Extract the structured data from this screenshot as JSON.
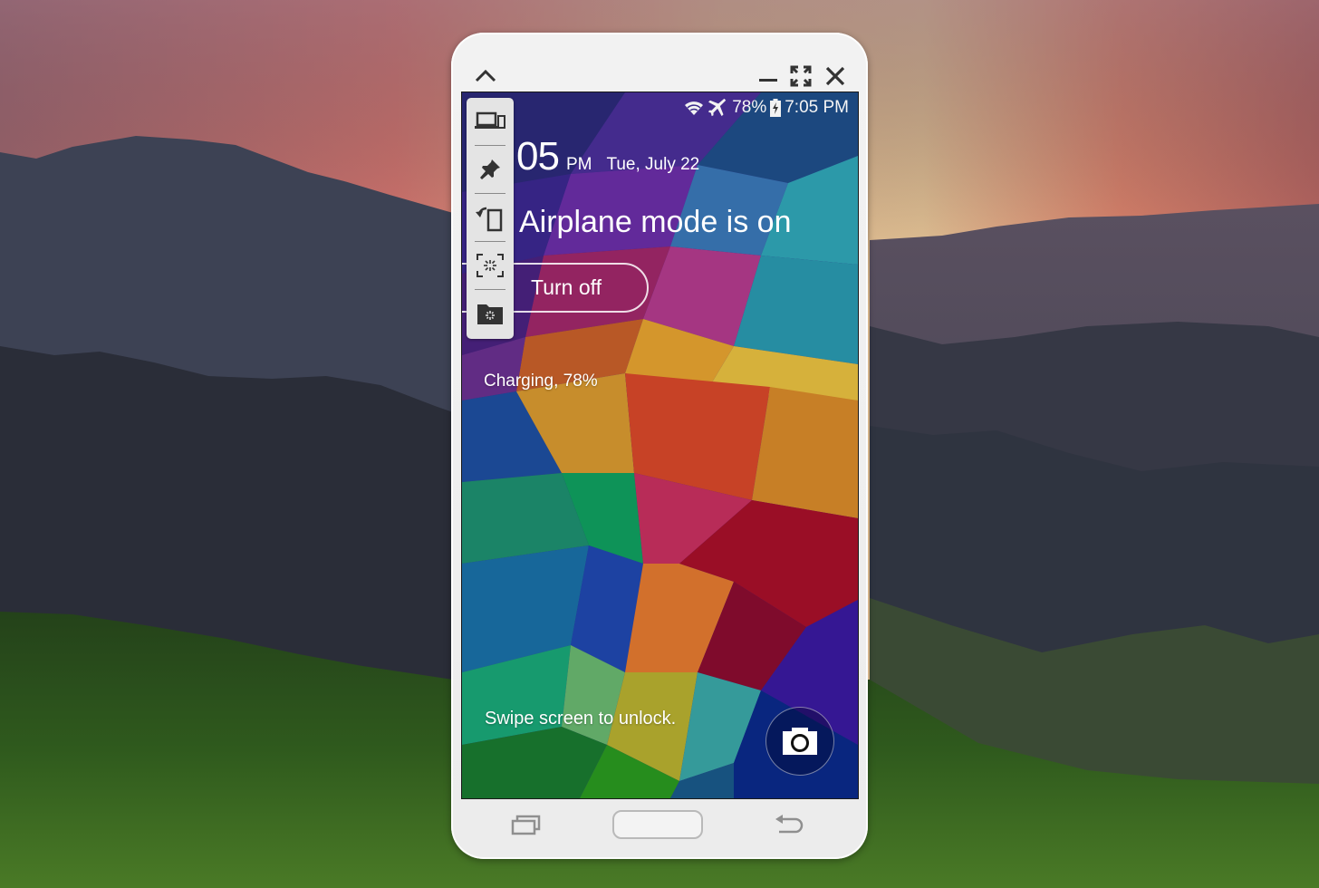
{
  "window": {
    "controls": {
      "collapse": "chevron-up",
      "minimize": "minimize",
      "maximize": "fullscreen",
      "close": "close"
    }
  },
  "status_bar": {
    "icons": [
      "wifi",
      "airplane-mode",
      "battery-charging"
    ],
    "battery_percent": "78%",
    "time": "7:05 PM"
  },
  "lockscreen": {
    "clock_minutes": "05",
    "clock_ampm": "PM",
    "date": "Tue, July 22",
    "notification_title": "Airplane mode is on",
    "turn_off_label": "Turn off",
    "charging_text": "Charging, 78%",
    "swipe_text": "Swipe screen to unlock.",
    "camera_shortcut": "camera"
  },
  "toolbar": {
    "items": [
      {
        "name": "device-screen",
        "icon": "laptop-phone"
      },
      {
        "name": "pin-window",
        "icon": "pin"
      },
      {
        "name": "rotate-screen",
        "icon": "rotate"
      },
      {
        "name": "capture-screen",
        "icon": "capture"
      },
      {
        "name": "save-to-folder",
        "icon": "folder-capture"
      }
    ]
  },
  "nav_bar": {
    "buttons": [
      "recent-apps",
      "home",
      "back"
    ]
  },
  "colors": {
    "frame": "#efefef",
    "icon_dark": "#333333",
    "nav_gray": "#8f8f8f",
    "sky_pink": "#e88070",
    "mountain": "#3a3d4c",
    "grass": "#2e5a1c"
  }
}
